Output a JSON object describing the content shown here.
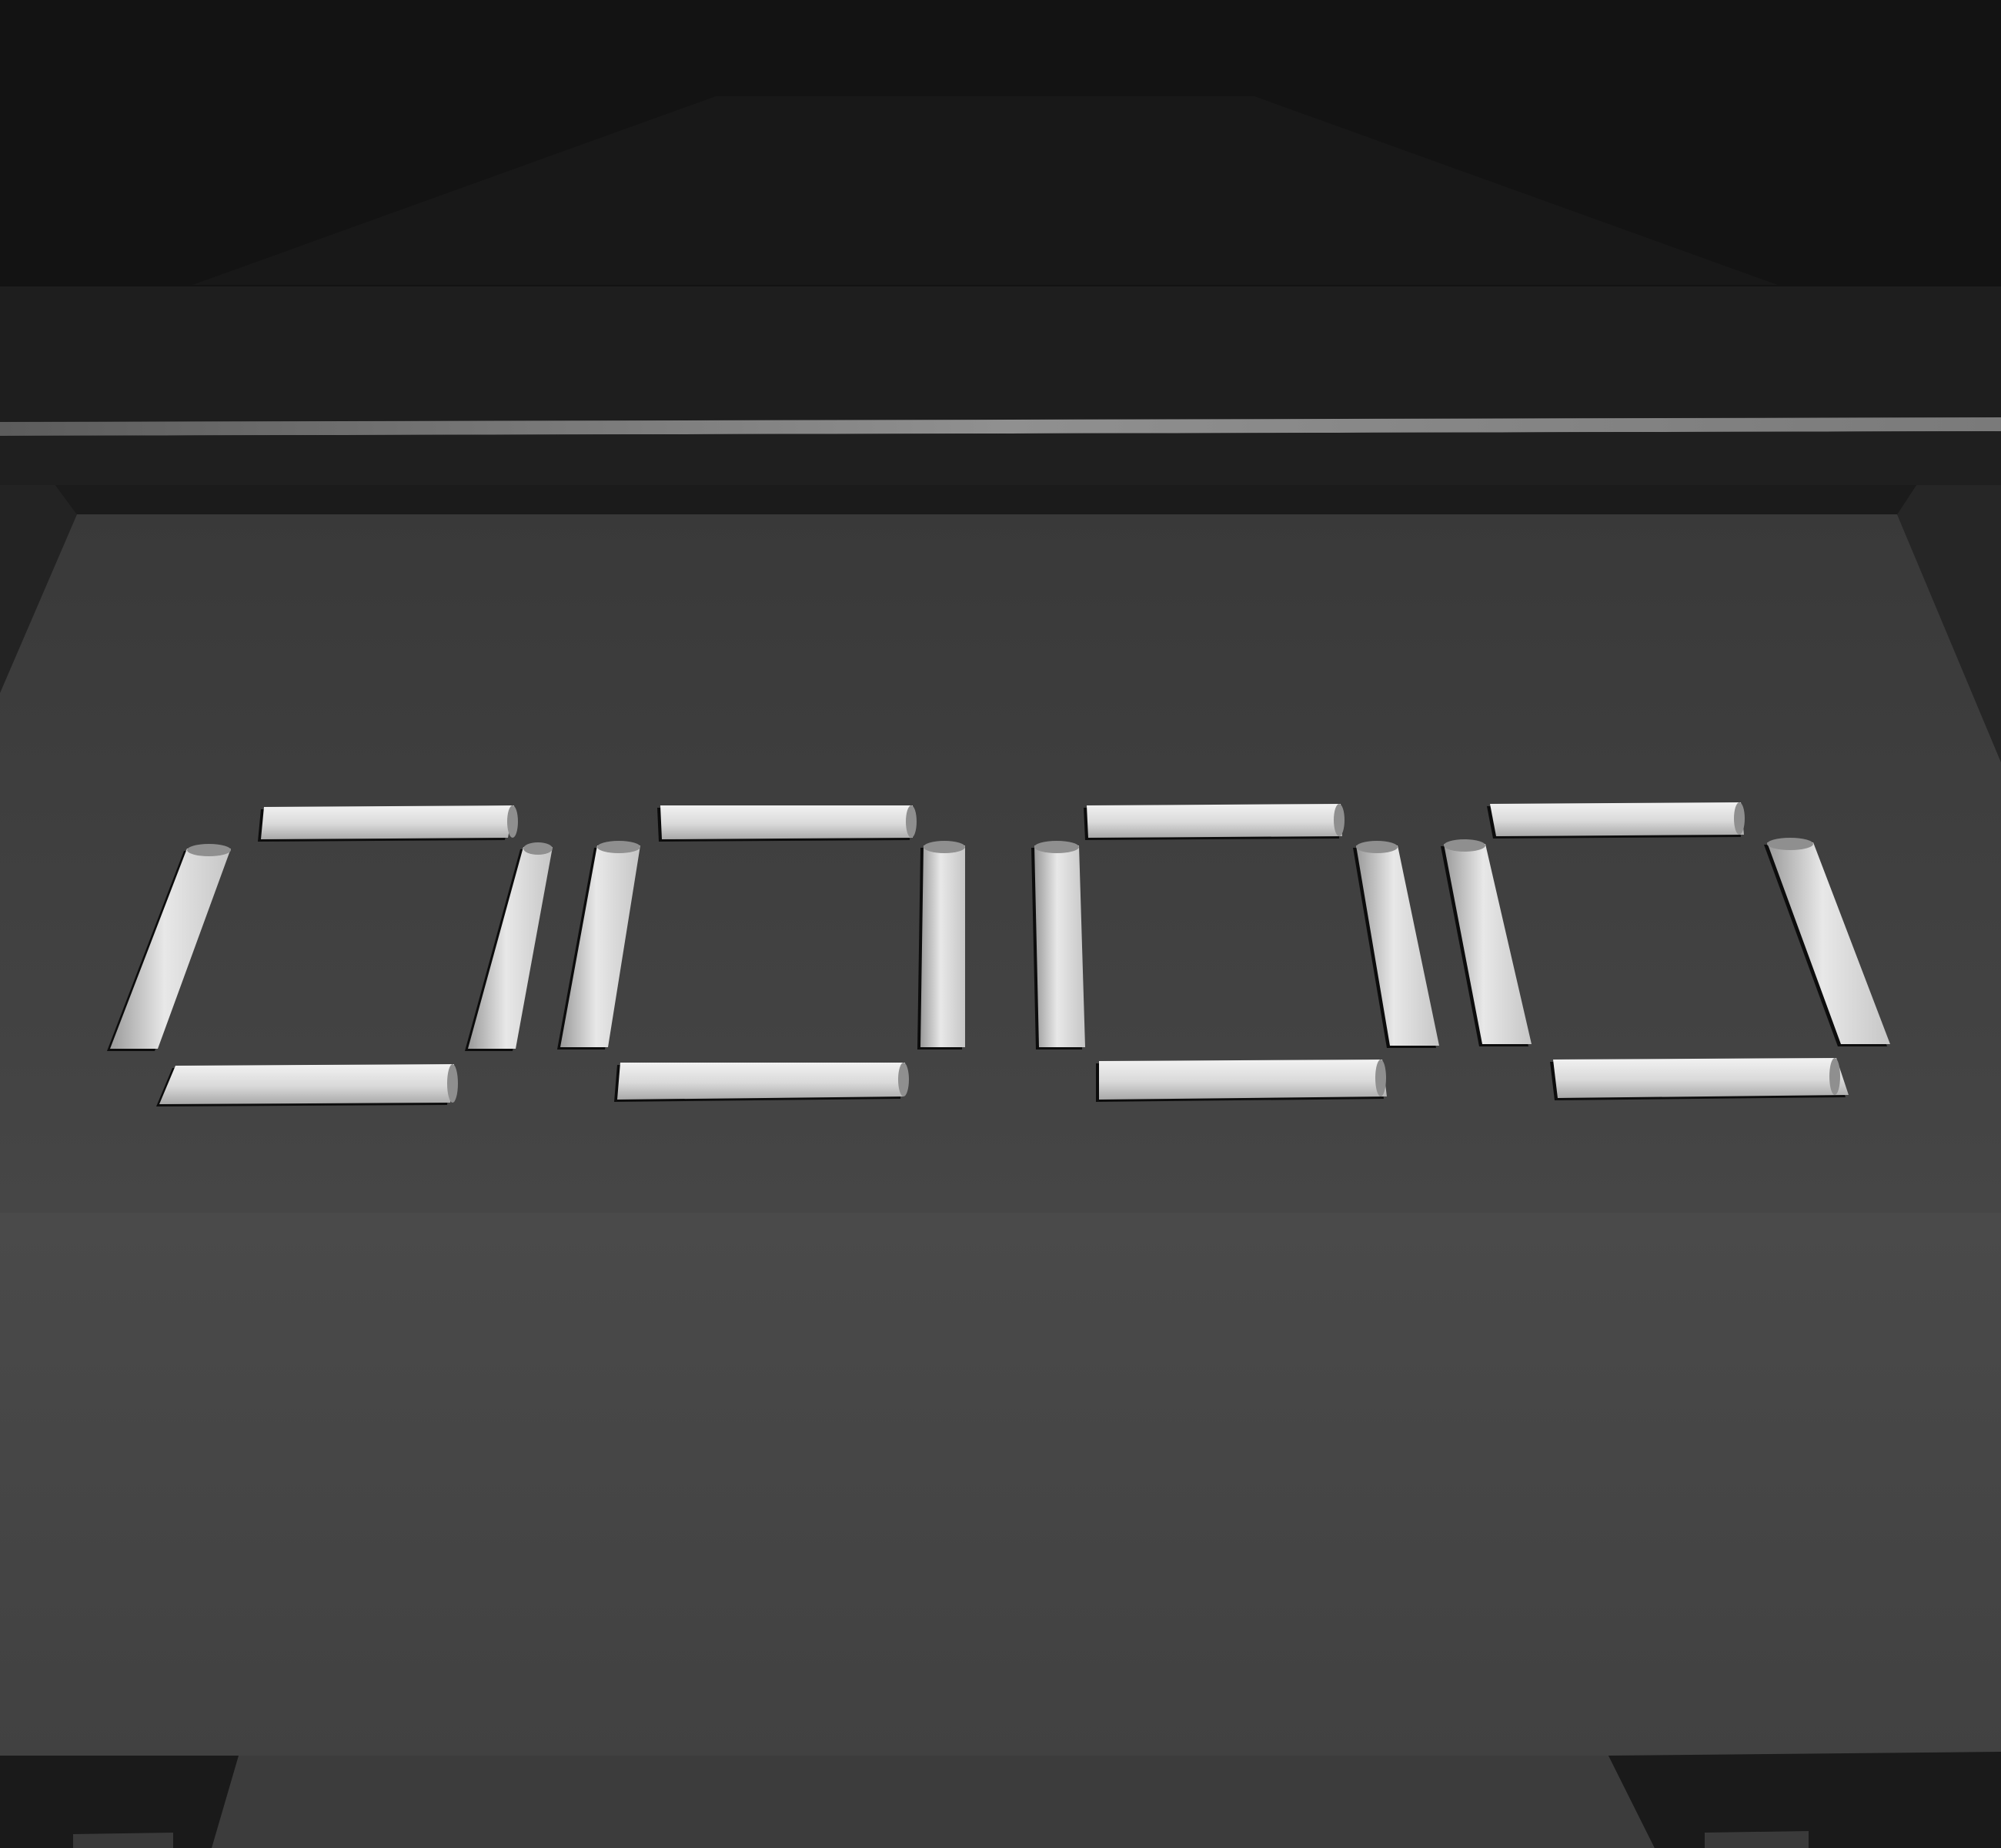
{
  "display": {
    "kind": "seven-segment",
    "digits": [
      {
        "segments": {
          "a": true,
          "b": true,
          "c": true,
          "d": true,
          "e": true,
          "f": true,
          "g": false
        }
      },
      {
        "segments": {
          "a": true,
          "b": true,
          "c": true,
          "d": true,
          "e": true,
          "f": true,
          "g": false
        }
      },
      {
        "segments": {
          "a": true,
          "b": true,
          "c": true,
          "d": true,
          "e": true,
          "f": true,
          "g": false
        }
      },
      {
        "segments": {
          "a": true,
          "b": true,
          "c": true,
          "d": true,
          "e": true,
          "f": true,
          "g": false
        }
      }
    ]
  },
  "colors": {
    "background": "#161616",
    "top_housing": "#171717",
    "top_bevel": "#121212",
    "ledge": "#1d1d1d",
    "ledge_highlight": "#8a8a8a",
    "side_wall": "#262626",
    "face_top": "#3a3a3a",
    "face_bottom": "#484848",
    "segment_light": "#f0f0f0",
    "segment_mid": "#cfcfcf",
    "segment_dark": "#8f8f8f",
    "segment_shadow": "#0c0c0c"
  }
}
